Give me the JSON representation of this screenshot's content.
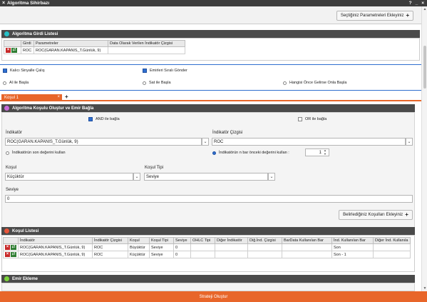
{
  "window": {
    "title": "Algoritma Sihirbazı",
    "help": "?",
    "minimize": "_",
    "close": "×"
  },
  "top_button": {
    "label": "Seçtiğiniz Parametreleri Ekleyiniz"
  },
  "input_list": {
    "title": "Algoritma Girdi Listesi",
    "dot_color": "#27c0c7",
    "columns": [
      "Girdi",
      "Parametreler",
      "Data Olarak Verilen İndikatör Çizgisi"
    ],
    "rows": [
      {
        "girdi": "ROC",
        "parametreler": "ROC(GARAN.KAPANIS_T.Günlük, 9)",
        "cizgi": ""
      }
    ]
  },
  "options": {
    "kalici": "Kalıcı Sinyalle Çalış",
    "emirleri": "Emirleri Sıralı Gönder",
    "al": "Al ile Başla",
    "sat": "Sat ile Başla",
    "hangisi": "Hangisi Önce Gelirse Onla Başla"
  },
  "tabs": {
    "active": "Koşul 1",
    "close": "×",
    "add": "+"
  },
  "condition_panel": {
    "title": "Algoritma Koşulu Oluştur ve Emir Bağla",
    "dot_color": "#c86ad8",
    "and_label": "AND ile bağla",
    "or_label": "OR ile bağla",
    "indikator_label": "İndikatör",
    "indikator_value": "ROC(GARAN.KAPANIS_T.Günlük, 9)",
    "cizgi_label": "İndikatör Çizgisi",
    "cizgi_value": "ROC",
    "son_deger": "İndikatörün son değerini kullan",
    "n_bar": "İndikatörün n bar önceki değerini kullan :",
    "n_bar_value": "1",
    "kosul_label": "Koşul",
    "kosul_value": "Küçüktür",
    "kosul_tipi_label": "Koşul Tipi",
    "kosul_tipi_value": "Seviye",
    "seviye_label": "Seviye",
    "seviye_value": "0",
    "add_button": "Belirlediğiniz Koşulları Ekleyiniz"
  },
  "condition_list": {
    "title": "Koşul Listesi",
    "dot_color": "#e8553a",
    "columns": [
      "İndikatör",
      "İndikatör Çizgisi",
      "Koşul",
      "Koşul Tipi",
      "Seviye",
      "OHLC Tipi",
      "Diğer İndikatör",
      "Diğ.İnd. Çizgisi",
      "BarData Kullanılan Bar",
      "İnd. Kullanılan Bar",
      "Diğer İnd. Kullanıla"
    ],
    "rows": [
      {
        "indikator": "ROC(GARAN.KAPANIS_T.Günlük, 9)",
        "cizgi": "ROC",
        "kosul": "Büyüktür",
        "tip": "Seviye",
        "seviye": "0",
        "bar": "Son"
      },
      {
        "indikator": "ROC(GARAN.KAPANIS_T.Günlük, 9)",
        "cizgi": "ROC",
        "kosul": "Küçüktür",
        "tip": "Seviye",
        "seviye": "0",
        "bar": "Son - 1"
      }
    ]
  },
  "order_panel": {
    "title": "Emir Ekleme",
    "dot_color": "#7bd33a"
  },
  "footer": {
    "label": "Strateji Oluştur"
  }
}
